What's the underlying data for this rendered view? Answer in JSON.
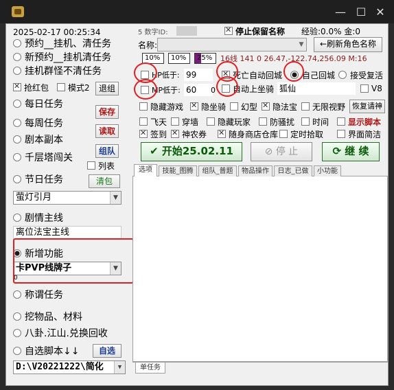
{
  "window": {
    "min": "—",
    "max": "☐",
    "close": "✕"
  },
  "left": {
    "datetime": "2025-02-17 00:25:34",
    "items": [
      {
        "label": "预约__挂机、清任务",
        "on": false
      },
      {
        "label": "新预约__挂机清任务",
        "on": false
      },
      {
        "label": "挂机群怪不清任务",
        "on": false
      }
    ],
    "qianghongbao": "抢红包",
    "moshi2": "模式2",
    "tuizu": "退组",
    "daily": "每日任务",
    "save": "保存",
    "weekly": "每周任务",
    "read": "读取",
    "dungeon": "剧本副本",
    "team": "组队",
    "tower": "千层塔闯关",
    "list": "列表",
    "festival": "节日任务",
    "clearbag": "清包",
    "festival_select": "萤灯引月",
    "mainline": "剧情主线",
    "mainline_value": "离位法宝主线",
    "newfeature": "新增功能",
    "newfeature_select": "卡PVP线牌子",
    "small_zero": "0",
    "title_task": "称谓任务",
    "dig": "挖物品、材料",
    "bagua": "八卦.江山.兑换回收",
    "script": "自选脚本↓↓",
    "choose": "自选",
    "path": "D:\\V20221222\\简化"
  },
  "right": {
    "id_label": "5 数字ID:",
    "stop_keep_name": "停止保留名称",
    "exp": "经验:0.0%  金:0",
    "name_label": "名称:",
    "refresh_btn": "←刷新角色名称",
    "bars": [
      "10%",
      "10%",
      "25%"
    ],
    "coords": "16线  141 0  26.47,-122.74,256.09  M:16",
    "hp_label": "HP低于:",
    "hp_value": "99",
    "mp_label": "MP低于:",
    "mp_value": "60",
    "mp_trail": "0",
    "death_return": "死亡自动回城",
    "self_return": "自己回城",
    "accept_revive": "接受复活",
    "auto_mount": "自动上坐骑",
    "mount_name": "狐仙",
    "v8": "V8",
    "opts1": [
      {
        "label": "隐藏游戏",
        "on": false
      },
      {
        "label": "隐坐骑",
        "on": true
      },
      {
        "label": "幻型",
        "on": false
      },
      {
        "label": "隐法宝",
        "on": true
      },
      {
        "label": "无限视野",
        "on": false
      }
    ],
    "restore": "恢复请神",
    "opts2": [
      {
        "label": "飞天",
        "on": false
      },
      {
        "label": "穿墙",
        "on": false
      },
      {
        "label": "隐藏玩家",
        "on": false
      },
      {
        "label": "防骚扰",
        "on": false
      },
      {
        "label": "时间",
        "on": false
      }
    ],
    "show_script": "显示脚本",
    "opts3": [
      {
        "label": "签到",
        "on": true
      },
      {
        "label": "神农券",
        "on": true
      },
      {
        "label": "随身商店仓库",
        "on": true
      },
      {
        "label": "定时拾取",
        "on": false
      }
    ],
    "ui_simple": "界面简洁",
    "start": "开始25.02.11",
    "stop": "停 止",
    "resume": "继 续",
    "tabs": [
      "选项",
      "技能_图腾",
      "组队_普题",
      "物品操作",
      "日志_已做",
      "小功能"
    ],
    "bottom_tab": "单任务"
  }
}
